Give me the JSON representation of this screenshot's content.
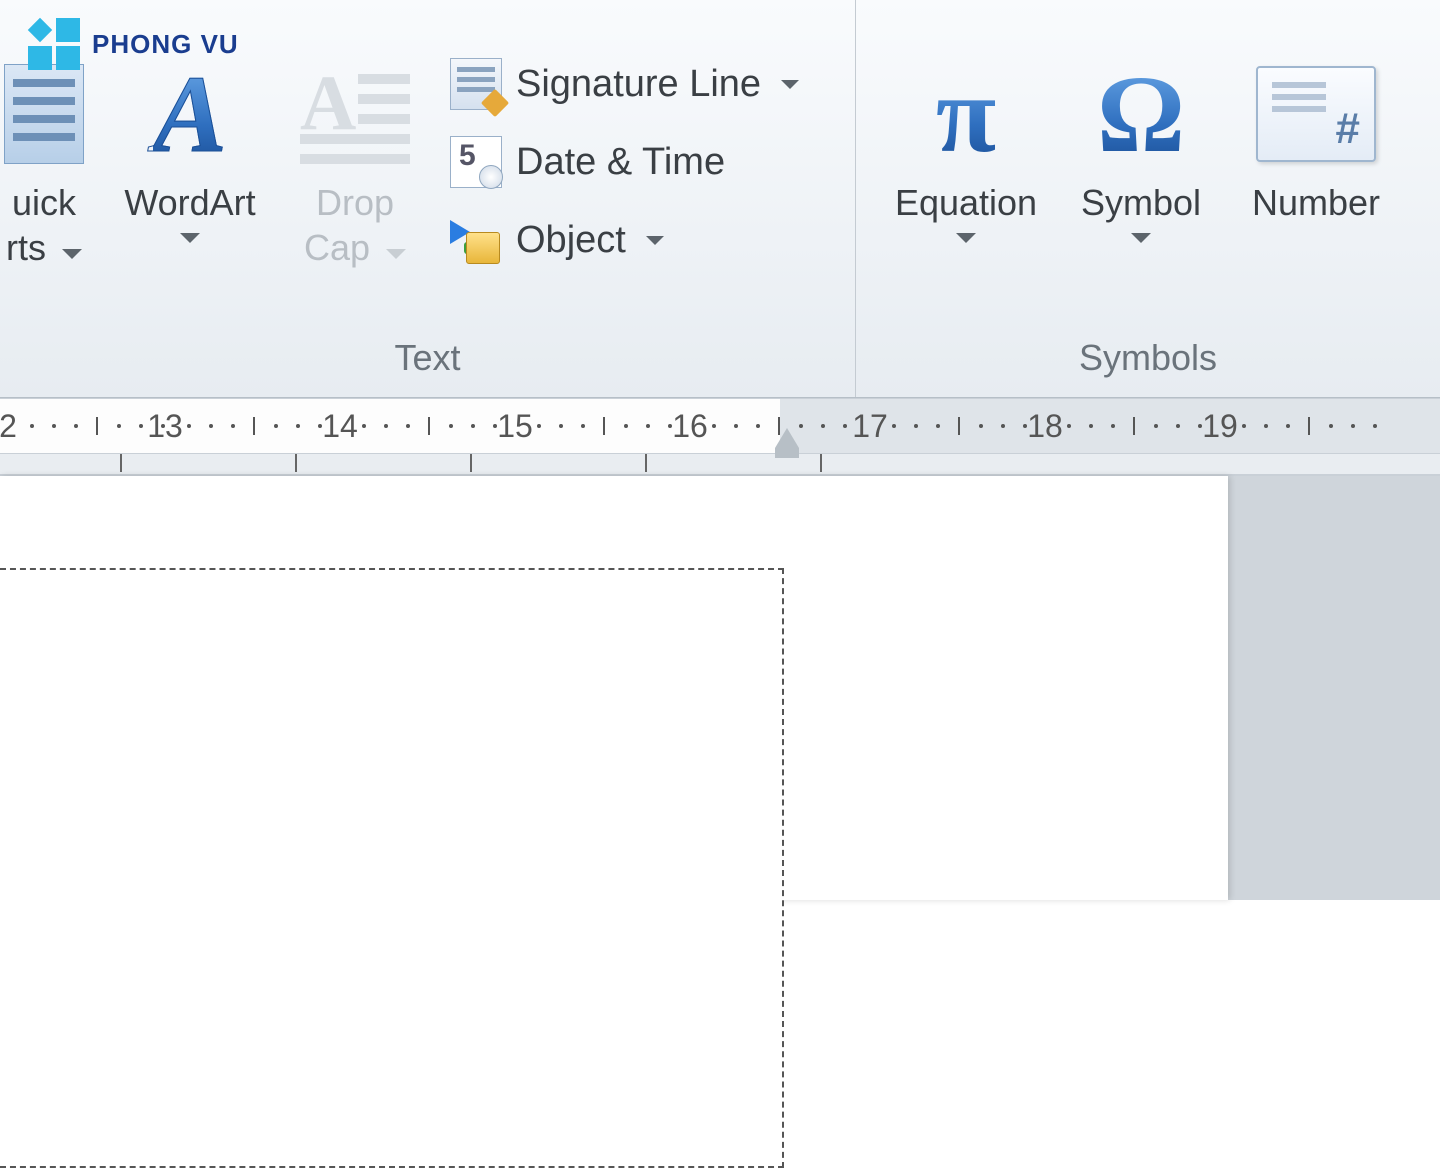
{
  "watermark": {
    "text": "PHONG VU"
  },
  "ribbon": {
    "groups": {
      "text": {
        "label": "Text",
        "quick_parts": {
          "line1": "uick",
          "line2": "rts"
        },
        "wordart": "WordArt",
        "dropcap": {
          "line1": "Drop",
          "line2": "Cap"
        },
        "signature_line": "Signature Line",
        "date_time": "Date & Time",
        "object": "Object"
      },
      "symbols": {
        "label": "Symbols",
        "equation": "Equation",
        "symbol": "Symbol",
        "number": "Number"
      }
    }
  },
  "ruler": {
    "numbers": [
      "2",
      "13",
      "14",
      "15",
      "16",
      "17",
      "18",
      "19"
    ]
  }
}
